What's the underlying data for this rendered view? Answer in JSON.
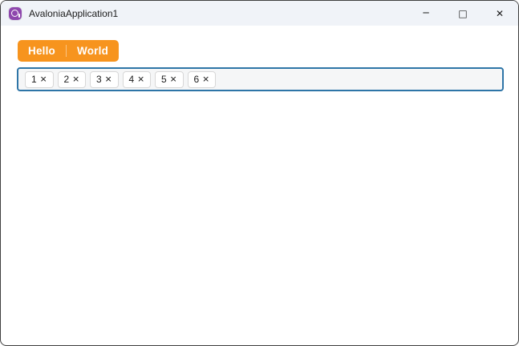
{
  "window": {
    "title": "AvaloniaApplication1",
    "controls": [
      {
        "name": "minimize",
        "glyph": "─"
      },
      {
        "name": "maximize",
        "glyph": "□"
      },
      {
        "name": "close",
        "glyph": "✕"
      }
    ]
  },
  "tabs": [
    {
      "label": "Hello"
    },
    {
      "label": "World"
    }
  ],
  "chip_input": {
    "chips": [
      {
        "label": "1",
        "remove_glyph": "✕"
      },
      {
        "label": "2",
        "remove_glyph": "✕"
      },
      {
        "label": "3",
        "remove_glyph": "✕"
      },
      {
        "label": "4",
        "remove_glyph": "✕"
      },
      {
        "label": "5",
        "remove_glyph": "✕"
      },
      {
        "label": "6",
        "remove_glyph": "✕"
      }
    ]
  },
  "colors": {
    "accent_orange": "#F7941E",
    "tab_text": "#FFFFFF",
    "titlebar_bg": "#F0F3F8",
    "content_bg": "#FFFFFF",
    "window_border": "#3F3F3F",
    "container_border": "#2E75A7",
    "container_bg": "#F5F6F7",
    "chip_bg": "#FFFFFF",
    "chip_border": "#D7D7D7",
    "text": "#1B1B1B",
    "logo_purple": "#8E47AD"
  }
}
